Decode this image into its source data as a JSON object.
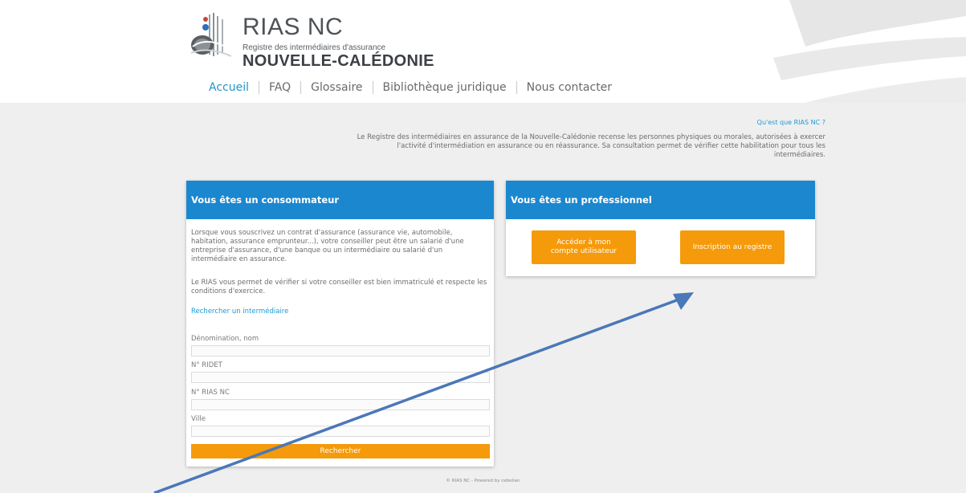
{
  "header": {
    "logo_title": "RIAS NC",
    "logo_subtitle": "Registre des intermédiaires d'assurance",
    "logo_region": "NOUVELLE-CALÉDONIE"
  },
  "nav": [
    {
      "label": "Accueil",
      "active": true
    },
    {
      "label": "FAQ",
      "active": false
    },
    {
      "label": "Glossaire",
      "active": false
    },
    {
      "label": "Bibliothèque juridique",
      "active": false
    },
    {
      "label": "Nous contacter",
      "active": false
    }
  ],
  "intro": {
    "link": "Qu'est que RIAS NC ?",
    "text": "Le Registre des intermédiaires en assurance de la Nouvelle-Calédonie recense les personnes physiques ou morales, autorisées à exercer l'activité d'intermédiation en assurance ou en réassurance. Sa consultation permet de vérifier cette habilitation pour tous les intermédiaires."
  },
  "consumer": {
    "title": "Vous êtes un consommateur",
    "paragraph1": "Lorsque vous souscrivez un contrat d'assurance (assurance vie, automobile, habitation, assurance emprunteur...), votre conseiller peut être un salarié d'une entreprise d'assurance, d'une banque ou un intermédiaire ou salarié d'un intermédiaire en assurance.",
    "paragraph2": "Le RIAS vous permet de vérifier si votre conseiller est bien immatriculé et respecte les conditions d'exercice.",
    "search_link": "Rechercher un intermédiaire",
    "fields": [
      {
        "label": "Dénomination, nom",
        "value": ""
      },
      {
        "label": "N° RIDET",
        "value": ""
      },
      {
        "label": "N° RIAS NC",
        "value": ""
      },
      {
        "label": "Ville",
        "value": ""
      }
    ],
    "search_button": "Rechercher"
  },
  "professional": {
    "title": "Vous êtes un professionnel",
    "account_button": "Accéder à mon compte utilisateur",
    "register_button": "Inscription au registre"
  },
  "footer": "© RIAS NC - Powered by cebelian",
  "colors": {
    "accent_blue": "#1b87cf",
    "button_orange": "#f59a0a",
    "background_gray": "#efefef",
    "annotation_arrow": "#4a78b8"
  }
}
